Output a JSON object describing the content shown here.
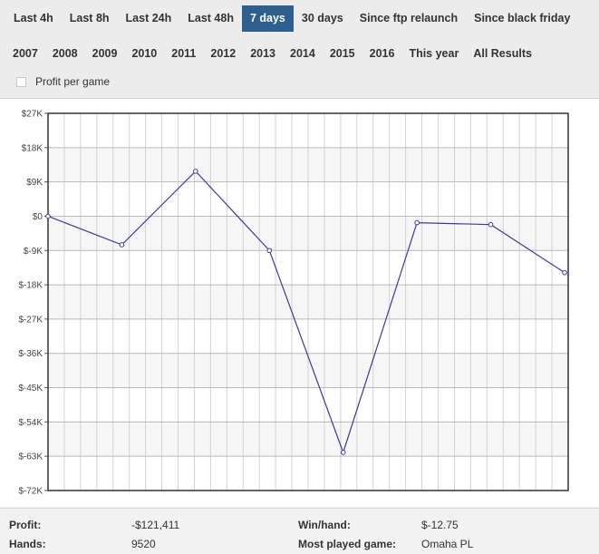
{
  "filters_row1": [
    {
      "label": "Last 4h",
      "active": false
    },
    {
      "label": "Last 8h",
      "active": false
    },
    {
      "label": "Last 24h",
      "active": false
    },
    {
      "label": "Last 48h",
      "active": false
    },
    {
      "label": "7 days",
      "active": true
    },
    {
      "label": "30 days",
      "active": false
    },
    {
      "label": "Since ftp relaunch",
      "active": false
    },
    {
      "label": "Since black friday",
      "active": false
    }
  ],
  "filters_row2": [
    {
      "label": "2007"
    },
    {
      "label": "2008"
    },
    {
      "label": "2009"
    },
    {
      "label": "2010"
    },
    {
      "label": "2011"
    },
    {
      "label": "2012"
    },
    {
      "label": "2013"
    },
    {
      "label": "2014"
    },
    {
      "label": "2015"
    },
    {
      "label": "2016"
    },
    {
      "label": "This year"
    },
    {
      "label": "All Results"
    }
  ],
  "profit_per_game": {
    "label": "Profit per game",
    "checked": false
  },
  "colors": {
    "active_filter": "#2e5f8f",
    "series_line": "#3b3b9a"
  },
  "chart_data": {
    "type": "line",
    "x": [
      0,
      1,
      2,
      3,
      4,
      5,
      6,
      7
    ],
    "series": [
      {
        "values": [
          0,
          -7500,
          11800,
          -9000,
          -62000,
          -1700,
          -2200,
          -14800
        ]
      }
    ],
    "ylim": [
      -72000,
      27000
    ],
    "y_ticks": [
      27000,
      18000,
      9000,
      0,
      -9000,
      -18000,
      -27000,
      -36000,
      -45000,
      -54000,
      -63000,
      -72000
    ],
    "y_tick_labels": [
      "$27K",
      "$18K",
      "$9K",
      "$0",
      "$-9K",
      "$-18K",
      "$-27K",
      "$-36K",
      "$-45K",
      "$-54K",
      "$-63K",
      "$-72K"
    ],
    "grid": true,
    "title": "",
    "xlabel": "",
    "ylabel": ""
  },
  "stats": {
    "profit_label": "Profit:",
    "profit_value": "-$121,411",
    "hands_label": "Hands:",
    "hands_value": "9520",
    "winhand_label": "Win/hand:",
    "winhand_value": "$-12.75",
    "mostplayed_label": "Most played game:",
    "mostplayed_value": "Omaha PL"
  }
}
